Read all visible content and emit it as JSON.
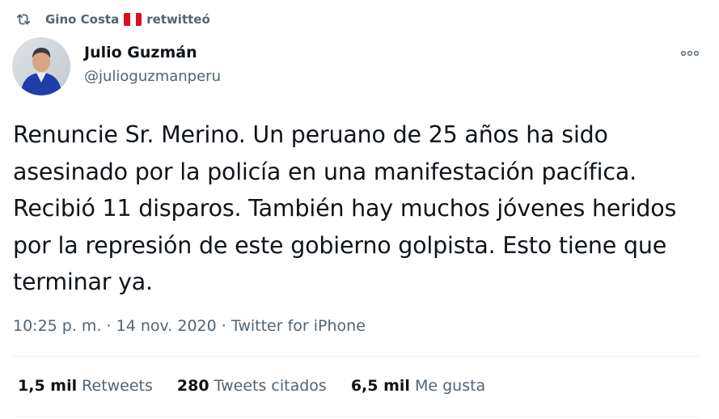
{
  "retweet": {
    "icon": "retweet-icon",
    "user": "Gino Costa",
    "flag": "peru-flag",
    "action": "retwitteó"
  },
  "author": {
    "name": "Julio Guzmán",
    "handle": "@julioguzmanperu",
    "avatar": "avatar"
  },
  "more_icon": "more-options-icon",
  "tweet": {
    "text": "Renuncie Sr. Merino. Un peruano de 25 años ha sido asesinado por la policía en una manifestación pacífica. Recibió 11 disparos. También hay muchos jóvenes heridos por la represión de este gobierno golpista. Esto tiene que terminar ya."
  },
  "meta": {
    "time": "10:25 p. m.",
    "separator": "·",
    "date": "14 nov. 2020",
    "source": "Twitter for iPhone"
  },
  "stats": {
    "retweets": {
      "count": "1,5 mil",
      "label": "Retweets"
    },
    "quotes": {
      "count": "280",
      "label": "Tweets citados"
    },
    "likes": {
      "count": "6,5 mil",
      "label": "Me gusta"
    }
  },
  "colors": {
    "primary_text": "#0f1419",
    "secondary_text": "#536471",
    "divider": "#eff3f4"
  }
}
